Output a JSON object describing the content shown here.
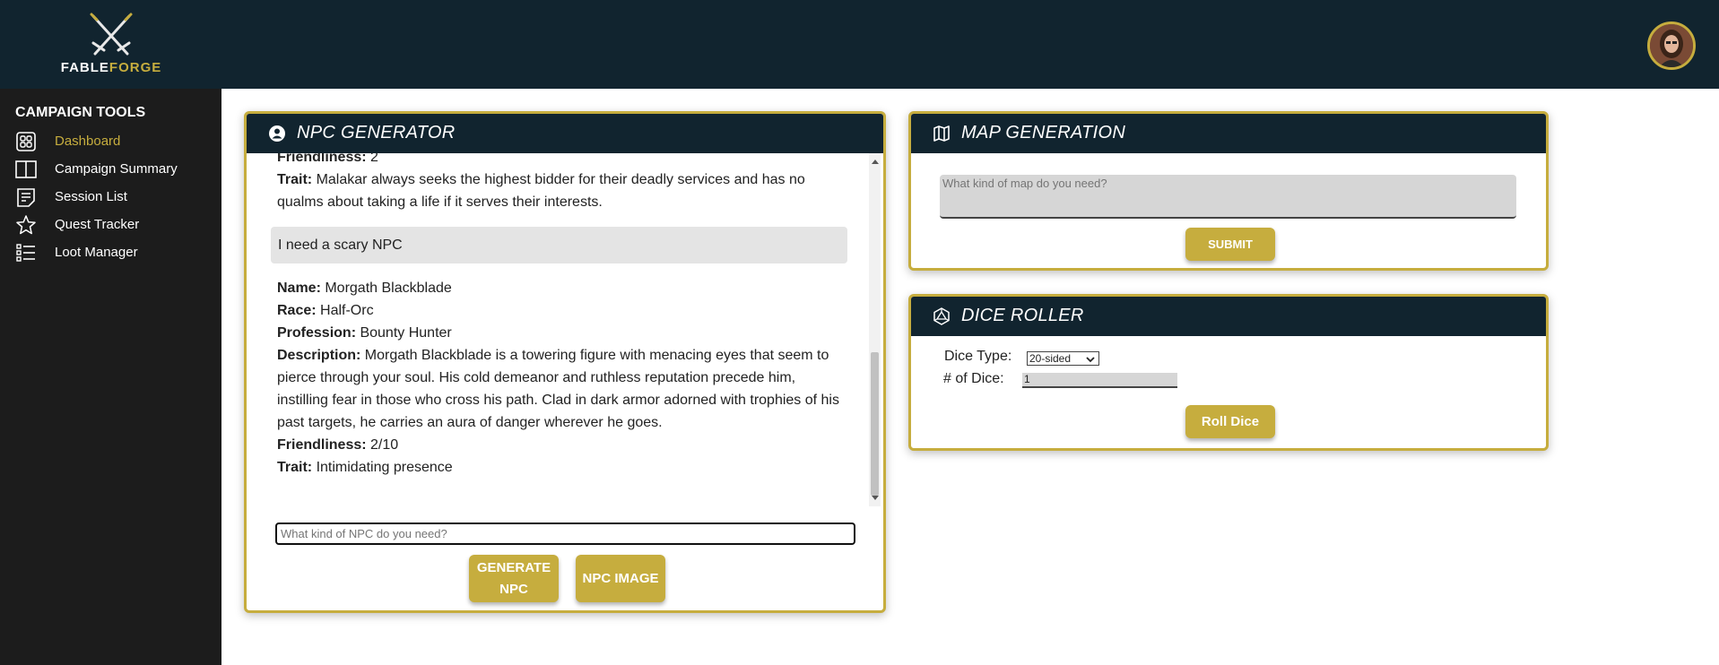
{
  "app": {
    "logo_part1": "FABLE",
    "logo_part2": "FORGE"
  },
  "sidebar": {
    "title": "CAMPAIGN TOOLS",
    "items": [
      {
        "label": "Dashboard",
        "icon": "dashboard-grid-icon",
        "active": true
      },
      {
        "label": "Campaign Summary",
        "icon": "book-open-icon",
        "active": false
      },
      {
        "label": "Session List",
        "icon": "list-document-icon",
        "active": false
      },
      {
        "label": "Quest Tracker",
        "icon": "star-icon",
        "active": false
      },
      {
        "label": "Loot Manager",
        "icon": "checklist-icon",
        "active": false
      }
    ]
  },
  "npc_generator": {
    "title": "NPC GENERATOR",
    "icon": "user-circle-icon",
    "previous": {
      "friendliness_label": "Friendliness:",
      "friendliness_value": " 2",
      "trait_label": "Trait:",
      "trait_value": " Malakar always seeks the highest bidder for their deadly services and has no qualms about taking a life if it serves their interests."
    },
    "user_message": "I need a scary NPC",
    "response": {
      "name_label": "Name:",
      "name_value": " Morgath Blackblade",
      "race_label": "Race:",
      "race_value": " Half-Orc",
      "profession_label": "Profession:",
      "profession_value": " Bounty Hunter",
      "description_label": "Description:",
      "description_value": " Morgath Blackblade is a towering figure with menacing eyes that seem to pierce through your soul. His cold demeanor and ruthless reputation precede him, instilling fear in those who cross his path. Clad in dark armor adorned with trophies of his past targets, he carries an aura of danger wherever he goes.",
      "friendliness_label": "Friendliness:",
      "friendliness_value": " 2/10",
      "trait_label": "Trait:",
      "trait_value": " Intimidating presence"
    },
    "input_placeholder": "What kind of NPC do you need?",
    "generate_line1": "GENERATE",
    "generate_line2": "NPC",
    "image_button": "NPC IMAGE"
  },
  "map_generation": {
    "title": "MAP GENERATION",
    "icon": "map-icon",
    "placeholder": "What kind of map do you need?",
    "submit": "SUBMIT"
  },
  "dice_roller": {
    "title": "DICE ROLLER",
    "icon": "d20-icon",
    "dice_type_label": "Dice Type:",
    "dice_type_value": "20-sided",
    "num_dice_label": "# of Dice:",
    "num_dice_value": "1",
    "roll_button": "Roll Dice"
  },
  "colors": {
    "header_bg": "#11242f",
    "sidebar_bg": "#1c1c1c",
    "accent_gold": "#c6ad3e"
  }
}
